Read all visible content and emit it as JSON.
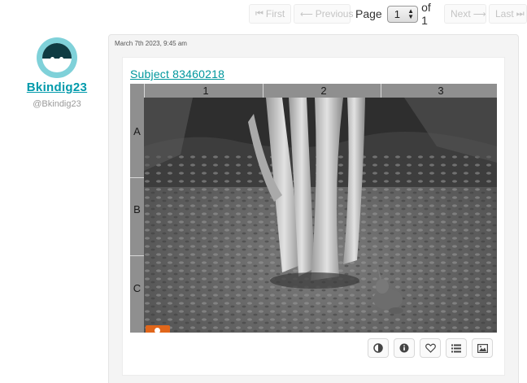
{
  "pagination": {
    "first_label": "First",
    "previous_label": "Previous",
    "page_label": "Page",
    "current_page": "1",
    "of_label": "of 1",
    "next_label": "Next",
    "last_label": "Last",
    "first_icon": "skip-back-icon",
    "previous_icon": "arrow-left-icon",
    "next_icon": "arrow-right-icon",
    "last_icon": "skip-forward-icon"
  },
  "user": {
    "display_name": "Bkindig23",
    "handle": "@Bkindig23",
    "avatar_color": "#7fd1d9"
  },
  "comment": {
    "timestamp": "March 7th 2023, 9:45 am",
    "subject_link": "Subject 83460218"
  },
  "grid": {
    "columns": [
      "1",
      "2",
      "3"
    ],
    "rows": [
      "A",
      "B",
      "C"
    ]
  },
  "toolbar": {
    "icons": [
      "contrast-icon",
      "info-icon",
      "heart-icon",
      "list-icon",
      "image-icon"
    ]
  },
  "colors": {
    "accent": "#009aab",
    "badge": "#e0661b"
  }
}
